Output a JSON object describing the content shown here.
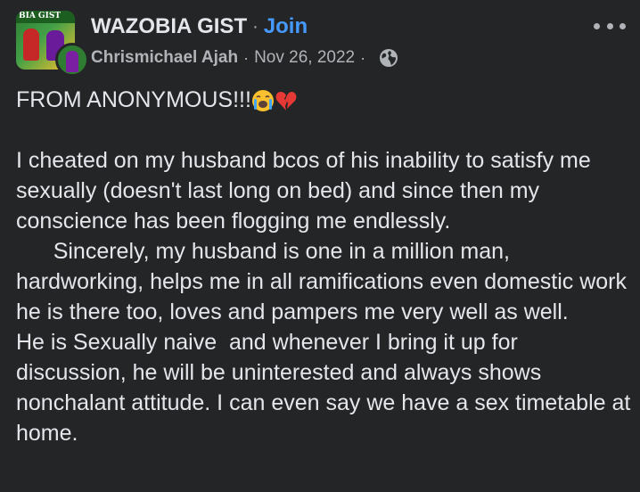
{
  "post": {
    "group_name": "WAZOBIA GIST",
    "group_avatar_text": "BIA GIST",
    "separator": "·",
    "join_label": "Join",
    "author": "Chrismichael Ajah",
    "date": "Nov 26, 2022",
    "privacy_icon": "globe-icon",
    "more_icon": "more-options-icon",
    "title_line": "FROM ANONYMOUS!!!",
    "title_emojis": [
      "crying-face-emoji",
      "broken-heart-emoji"
    ],
    "paragraphs": [
      "I cheated on my husband bcos of his inability to satisfy me sexually (doesn't last long on bed) and since then my conscience has been flogging me endlessly.",
      "      Sincerely, my husband is one in a million man, hardworking, helps me in all ramifications even domestic work he is there too, loves and pampers me very well as well.",
      "He is Sexually naive  and whenever I bring it up for discussion, he will be uninterested and always shows nonchalant attitude. I can even say we have a sex timetable at home."
    ]
  },
  "colors": {
    "background": "#242526",
    "text": "#e4e6eb",
    "secondary_text": "#b0b3b8",
    "link": "#4599ff"
  }
}
